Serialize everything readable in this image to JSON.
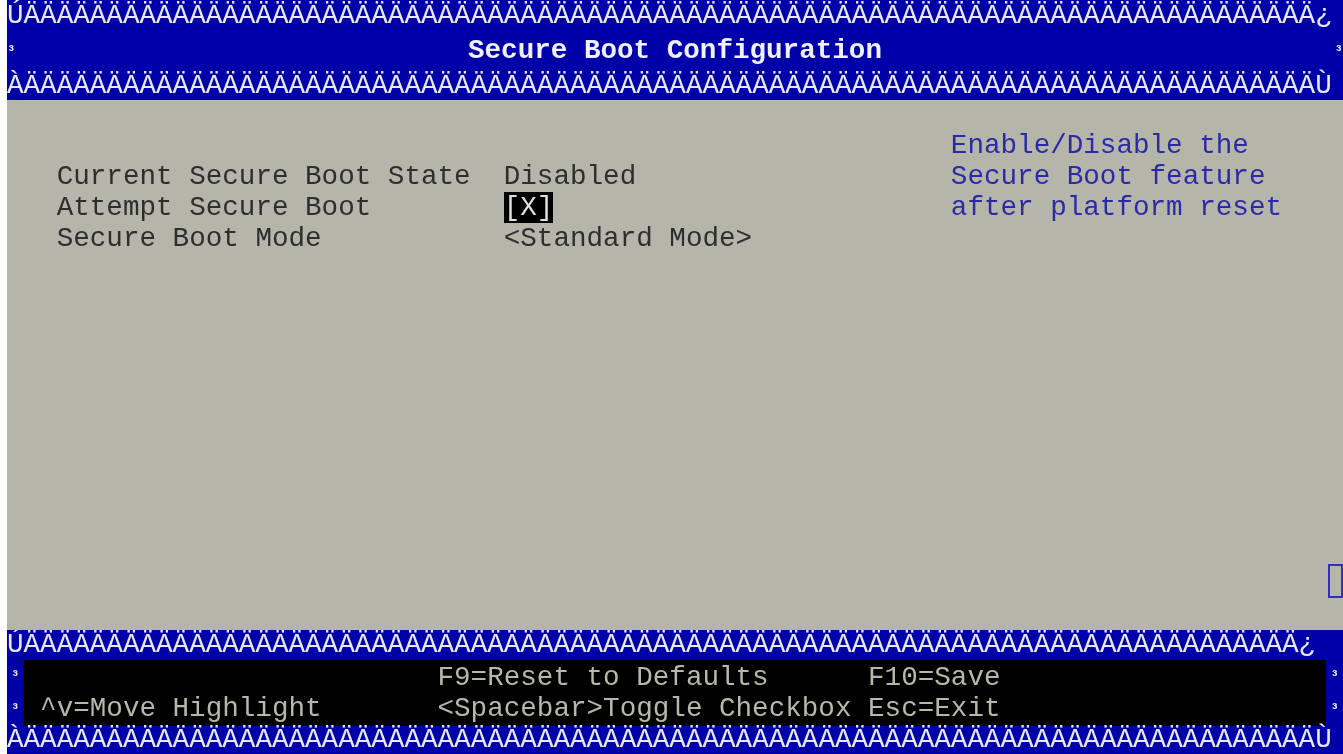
{
  "header": {
    "top_border": "ÚÄÄÄÄÄÄÄÄÄÄÄÄÄÄÄÄÄÄÄÄÄÄÄÄÄÄÄÄÄÄÄÄÄÄÄÄÄÄÄÄÄÄÄÄÄÄÄÄÄÄÄÄÄÄÄÄÄÄÄÄÄÄÄÄÄÄÄÄÄÄÄÄÄÄÄÄÄÄ¿",
    "left_edge": "³",
    "title": "Secure Boot Configuration",
    "right_edge": "³",
    "bottom_border": "ÀÄÄÄÄÄÄÄÄÄÄÄÄÄÄÄÄÄÄÄÄÄÄÄÄÄÄÄÄÄÄÄÄÄÄÄÄÄÄÄÄÄÄÄÄÄÄÄÄÄÄÄÄÄÄÄÄÄÄÄÄÄÄÄÄÄÄÄÄÄÄÄÄÄÄÄÄÄÄÙ"
  },
  "items": [
    {
      "label": "Current Secure Boot State",
      "value": "Disabled",
      "selected": false
    },
    {
      "label": "Attempt Secure Boot",
      "value": "[X]",
      "selected": true
    },
    {
      "label": "Secure Boot Mode",
      "value": "<Standard Mode>",
      "selected": false
    }
  ],
  "help_text": "Enable/Disable the Secure Boot feature after platform reset",
  "footer": {
    "top_border": "ÚÄÄÄÄÄÄÄÄÄÄÄÄÄÄÄÄÄÄÄÄÄÄÄÄÄÄÄÄÄÄÄÄÄÄÄÄÄÄÄÄÄÄÄÄÄÄÄÄÄÄÄÄÄÄÄÄÄÄÄÄÄÄÄÄÄÄÄÄÄÄÄÄÄÄÄÄÄ¿",
    "edges": [
      {
        "left": "³",
        "right": "³"
      },
      {
        "left": "³",
        "right": "³"
      }
    ],
    "columns": [
      [
        "^v=Move Highlight"
      ],
      [
        "F9=Reset to Defaults",
        "<Spacebar>Toggle Checkbox"
      ],
      [
        "F10=Save",
        "Esc=Exit"
      ]
    ],
    "bottom_border": "ÀÄÄÄÄÄÄÄÄÄÄÄÄÄÄÄÄÄÄÄÄÄÄÄÄÄÄÄÄÄÄÄÄÄÄÄÄÄÄÄÄÄÄÄÄÄÄÄÄÄÄÄÄÄÄÄÄÄÄÄÄÄÄÄÄÄÄÄÄÄÄÄÄÄÄÄÄÄÄÙ"
  }
}
